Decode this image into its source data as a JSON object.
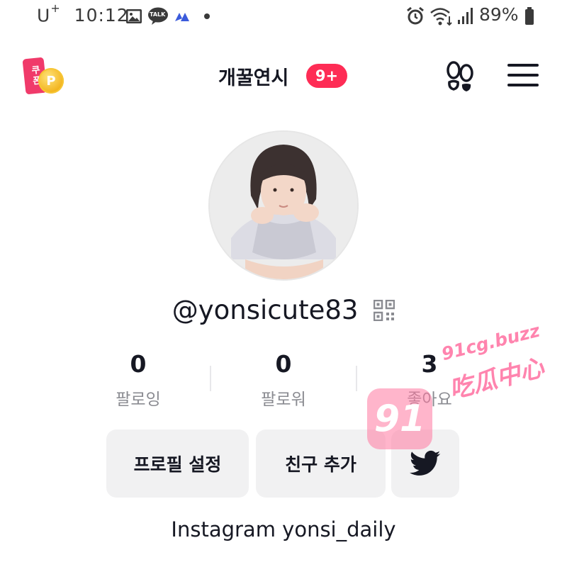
{
  "status_bar": {
    "carrier": "U",
    "carrier_sup": "+",
    "time": "10:12",
    "notification_icons": [
      "gallery-icon",
      "kakaotalk-icon",
      "app-icon",
      "dot-icon"
    ],
    "kakao_label": "TALK",
    "right_icons": [
      "alarm-icon",
      "wifi-icon",
      "signal-icon",
      "battery-icon"
    ],
    "battery": "89%"
  },
  "header": {
    "title": "개꿀연시",
    "badge": "9+",
    "coupon": {
      "ticket_label": "쿠폰",
      "coin_label": "P"
    },
    "icons": [
      "footprints-icon",
      "menu-icon"
    ]
  },
  "profile": {
    "username": "@yonsicute83",
    "qr_icon": "qr-code-icon"
  },
  "stats": [
    {
      "value": "0",
      "label": "팔로잉"
    },
    {
      "value": "0",
      "label": "팔로워"
    },
    {
      "value": "3",
      "label": "좋아요"
    }
  ],
  "actions": {
    "edit_profile": "프로필 설정",
    "add_friend": "친구 추가",
    "twitter_icon": "twitter-icon"
  },
  "bio": "Instagram yonsi_daily",
  "watermark": {
    "logo": "91",
    "url": "91cg.buzz",
    "text": "吃瓜中心"
  },
  "colors": {
    "badge": "#fe2c55",
    "button_bg": "#f1f1f2",
    "label_gray": "#8a8b91",
    "twitter": "#161823"
  }
}
